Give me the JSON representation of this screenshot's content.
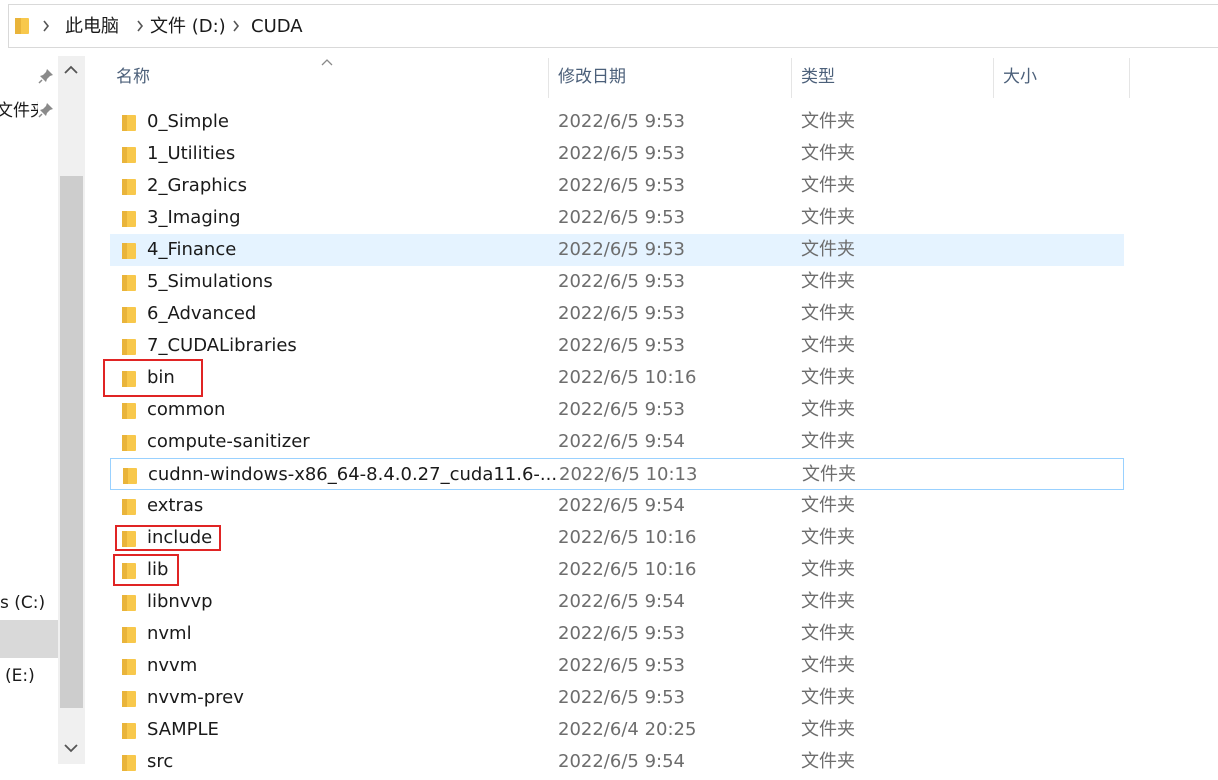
{
  "address_bar": {
    "crumbs": [
      "此电脑",
      "文件 (D:)",
      "CUDA"
    ]
  },
  "nav": {
    "items": [
      {
        "label": "文件夹",
        "pinned": true
      },
      {
        "label": "s (C:)"
      },
      {
        "label": "(E:)"
      }
    ]
  },
  "columns": {
    "name": "名称",
    "modified": "修改日期",
    "type": "类型",
    "size": "大小"
  },
  "files": [
    {
      "name": "0_Simple",
      "modified": "2022/6/5 9:53",
      "type": "文件夹"
    },
    {
      "name": "1_Utilities",
      "modified": "2022/6/5 9:53",
      "type": "文件夹"
    },
    {
      "name": "2_Graphics",
      "modified": "2022/6/5 9:53",
      "type": "文件夹"
    },
    {
      "name": "3_Imaging",
      "modified": "2022/6/5 9:53",
      "type": "文件夹"
    },
    {
      "name": "4_Finance",
      "modified": "2022/6/5 9:53",
      "type": "文件夹",
      "state": "hover"
    },
    {
      "name": "5_Simulations",
      "modified": "2022/6/5 9:53",
      "type": "文件夹"
    },
    {
      "name": "6_Advanced",
      "modified": "2022/6/5 9:53",
      "type": "文件夹"
    },
    {
      "name": "7_CUDALibraries",
      "modified": "2022/6/5 9:53",
      "type": "文件夹"
    },
    {
      "name": "bin",
      "modified": "2022/6/5 10:16",
      "type": "文件夹",
      "highlighted": true
    },
    {
      "name": "common",
      "modified": "2022/6/5 9:53",
      "type": "文件夹"
    },
    {
      "name": "compute-sanitizer",
      "modified": "2022/6/5 9:54",
      "type": "文件夹"
    },
    {
      "name": "cudnn-windows-x86_64-8.4.0.27_cuda11.6-...",
      "modified": "2022/6/5 10:13",
      "type": "文件夹",
      "state": "focus"
    },
    {
      "name": "extras",
      "modified": "2022/6/5 9:54",
      "type": "文件夹"
    },
    {
      "name": "include",
      "modified": "2022/6/5 10:16",
      "type": "文件夹",
      "highlighted": true
    },
    {
      "name": "lib",
      "modified": "2022/6/5 10:16",
      "type": "文件夹",
      "highlighted": true
    },
    {
      "name": "libnvvp",
      "modified": "2022/6/5 9:54",
      "type": "文件夹"
    },
    {
      "name": "nvml",
      "modified": "2022/6/5 9:53",
      "type": "文件夹"
    },
    {
      "name": "nvvm",
      "modified": "2022/6/5 9:53",
      "type": "文件夹"
    },
    {
      "name": "nvvm-prev",
      "modified": "2022/6/5 9:53",
      "type": "文件夹"
    },
    {
      "name": "SAMPLE",
      "modified": "2022/6/4 20:25",
      "type": "文件夹"
    },
    {
      "name": "src",
      "modified": "2022/6/5 9:54",
      "type": "文件夹"
    }
  ],
  "colors": {
    "folder": "#f8c84c",
    "hover_row": "#e5f3ff",
    "focus_border": "#99d1ff",
    "annotation_red": "#e02424",
    "header_text": "#4c607a"
  }
}
